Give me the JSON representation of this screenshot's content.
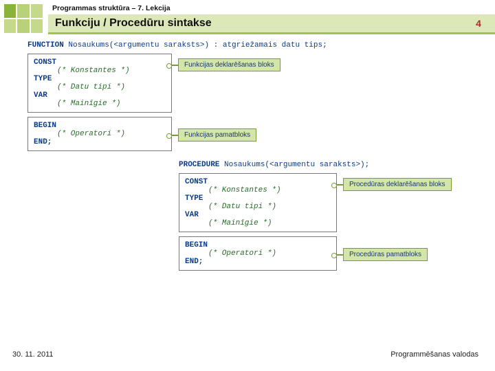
{
  "header": {
    "breadcrumb": "Programmas struktūra – 7. Lekcija",
    "title": "Funkciju / Procedūru sintakse",
    "page_number": "4"
  },
  "function": {
    "signature_kw": "FUNCTION",
    "signature_rest": " Nosaukums(<argumentu saraksts>) : atgriežamais datu tips;",
    "decl": {
      "const_kw": "CONST",
      "const_cm": "(* Konstantes *)",
      "type_kw": "TYPE",
      "type_cm": "(* Datu tipi *)",
      "var_kw": "VAR",
      "var_cm": "(* Mainīgie *)"
    },
    "body": {
      "begin_kw": "BEGIN",
      "ops_cm": "(* Operatori *)",
      "end_kw": "END;"
    },
    "callout_decl": "Funkcijas deklarēšanas bloks",
    "callout_body": "Funkcijas pamatbloks"
  },
  "procedure": {
    "signature_kw": "PROCEDURE",
    "signature_rest": " Nosaukums(<argumentu saraksts>);",
    "decl": {
      "const_kw": "CONST",
      "const_cm": "(* Konstantes *)",
      "type_kw": "TYPE",
      "type_cm": "(* Datu tipi *)",
      "var_kw": "VAR",
      "var_cm": "(* Mainīgie *)"
    },
    "body": {
      "begin_kw": "BEGIN",
      "ops_cm": "(* Operatori *)",
      "end_kw": "END;"
    },
    "callout_decl": "Procedūras deklarēšanas bloks",
    "callout_body": "Procedūras pamatbloks"
  },
  "footer": {
    "date": "30. 11. 2011",
    "course": "Programmēšanas valodas"
  }
}
